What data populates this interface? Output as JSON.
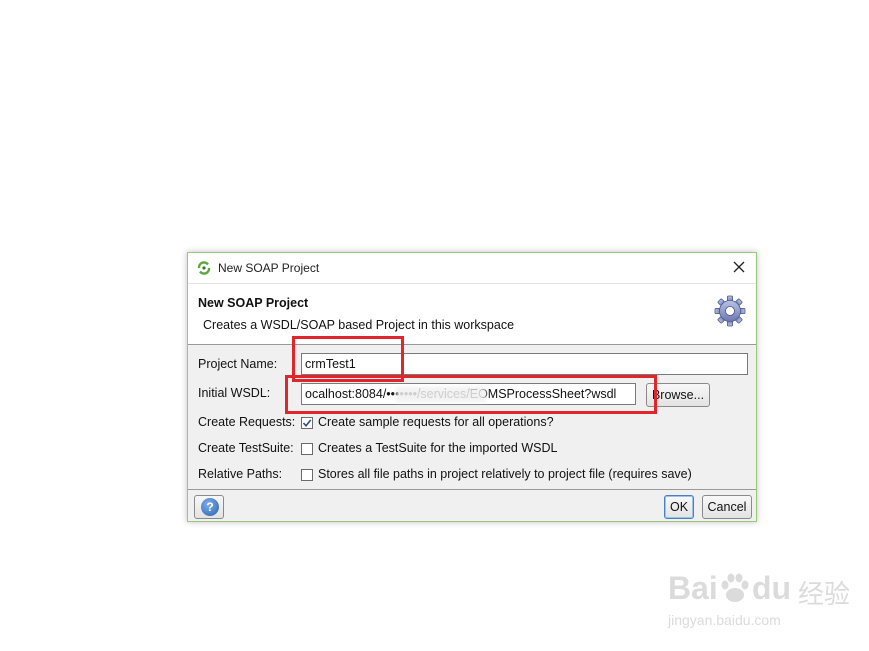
{
  "window": {
    "title": "New SOAP Project",
    "icon": "soapui-icon",
    "close_icon": "close-icon"
  },
  "header": {
    "title": "New SOAP Project",
    "description": "Creates a WSDL/SOAP based Project in this workspace",
    "icon": "gear-icon"
  },
  "form": {
    "project_name_label": "Project Name:",
    "project_name_value": "crmTest1",
    "initial_wsdl_label": "Initial WSDL:",
    "initial_wsdl_value": "ocalhost:8084/•••••••/services/EOMSProcessSheet?wsdl",
    "browse_label": "Browse...",
    "create_requests_label": "Create Requests:",
    "create_requests_text": "Create sample requests for all operations?",
    "create_requests_checked": true,
    "create_testsuite_label": "Create TestSuite:",
    "create_testsuite_text": "Creates a TestSuite for the imported WSDL",
    "create_testsuite_checked": false,
    "relative_paths_label": "Relative Paths:",
    "relative_paths_text": "Stores all file paths in project relatively to project file (requires save)",
    "relative_paths_checked": false
  },
  "footer": {
    "help_icon": "help-icon",
    "ok_label": "OK",
    "cancel_label": "Cancel"
  },
  "watermark": {
    "brand": "Bai",
    "brand2": "du",
    "cn": "经验",
    "url": "jingyan.baidu.com"
  },
  "colors": {
    "highlight": "#e0262a",
    "dialog_border": "#9ac87a",
    "default_button_border": "#4a7fc0"
  }
}
